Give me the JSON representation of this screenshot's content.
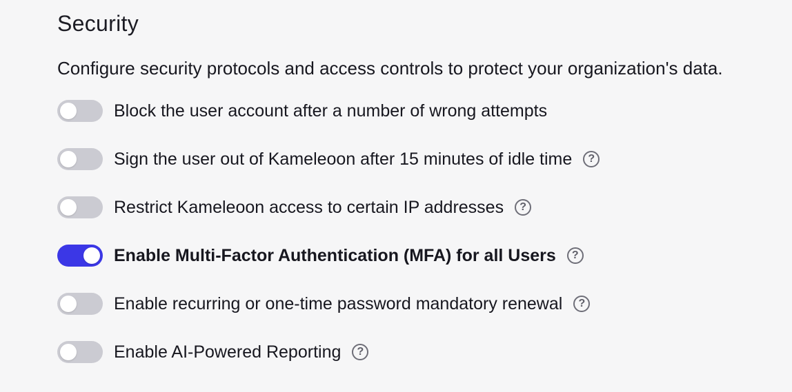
{
  "section": {
    "title": "Security",
    "description": "Configure security protocols and access controls to protect your organization's data."
  },
  "settings": [
    {
      "label": "Block the user account after a number of wrong attempts",
      "enabled": false,
      "has_help": false
    },
    {
      "label": "Sign the user out of Kameleoon after 15 minutes of idle time",
      "enabled": false,
      "has_help": true
    },
    {
      "label": "Restrict Kameleoon access to certain IP addresses",
      "enabled": false,
      "has_help": true
    },
    {
      "label": "Enable Multi-Factor Authentication (MFA) for all Users",
      "enabled": true,
      "has_help": true
    },
    {
      "label": "Enable recurring or one-time password mandatory renewal",
      "enabled": false,
      "has_help": true
    },
    {
      "label": "Enable AI-Powered Reporting",
      "enabled": false,
      "has_help": true
    }
  ],
  "help_icon": {
    "glyph": "?",
    "name": "help-circle-icon"
  },
  "colors": {
    "toggle_on": "#3b37e6",
    "toggle_off": "#cbcbd2",
    "background": "#f6f6f7",
    "text": "#17171f"
  }
}
